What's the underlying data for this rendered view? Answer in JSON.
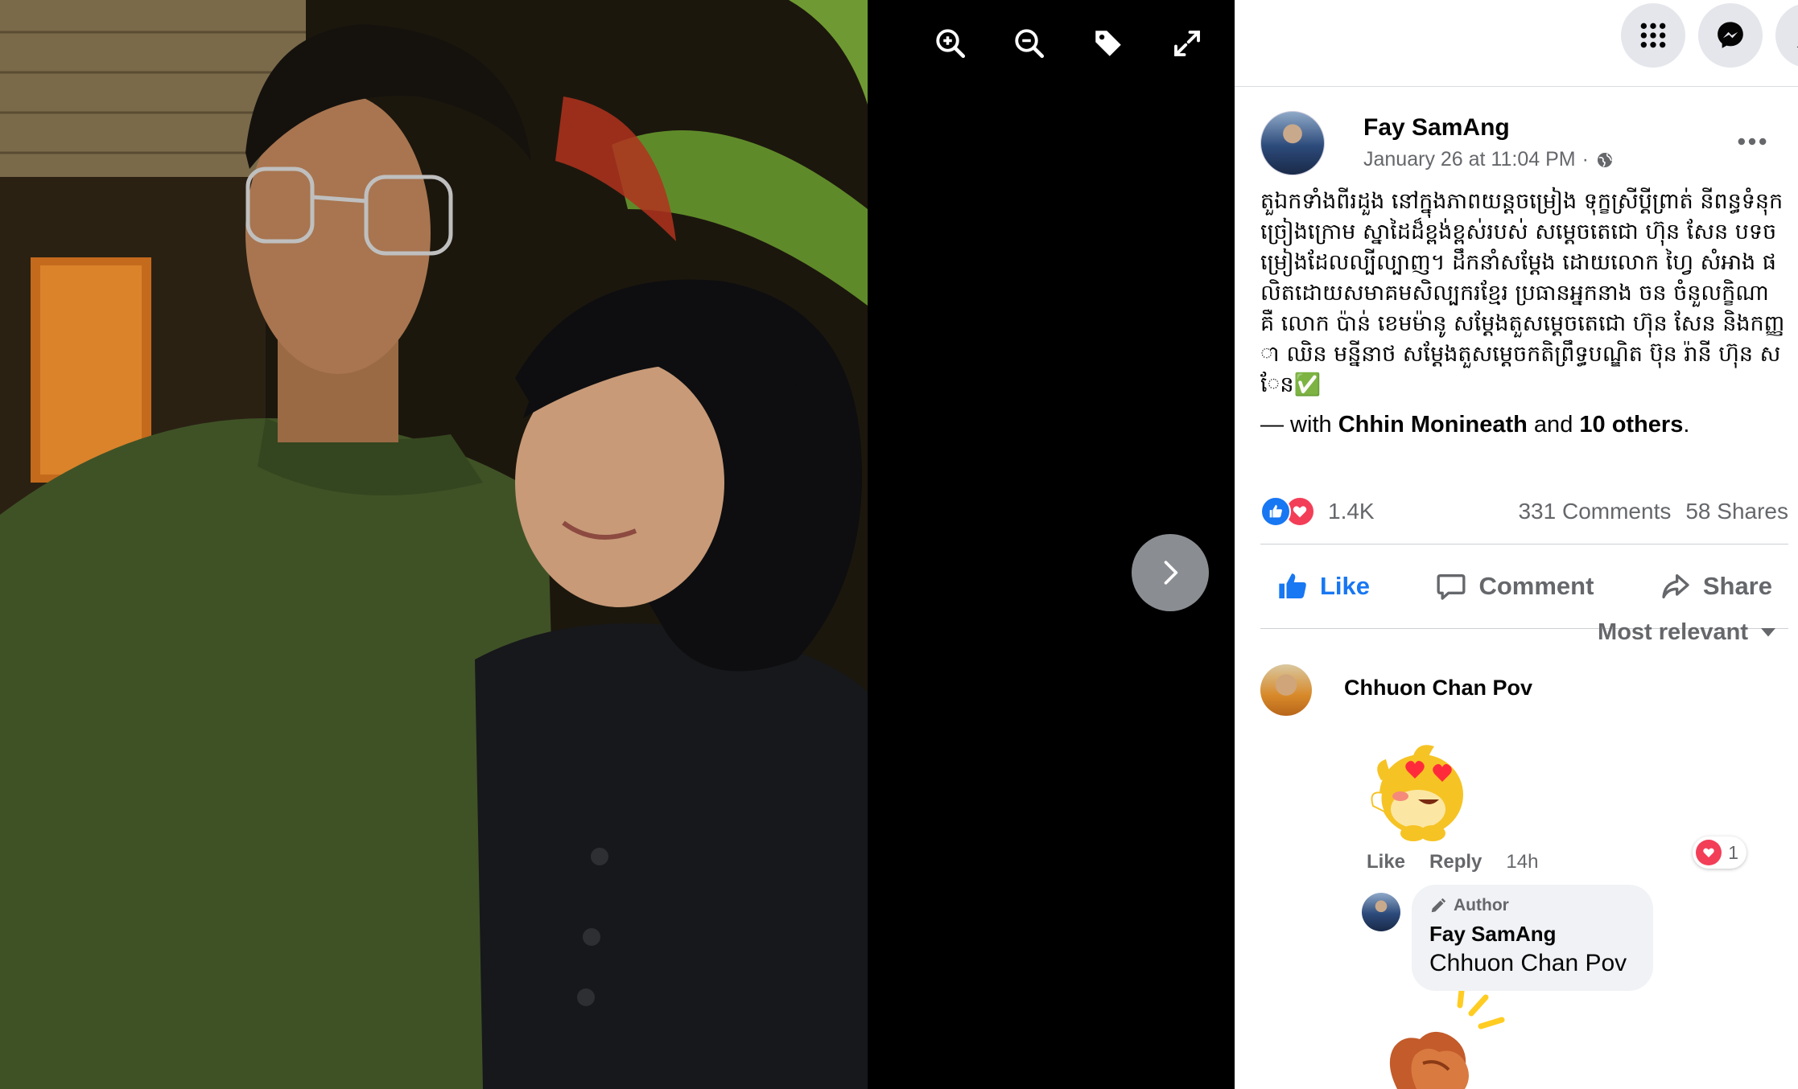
{
  "viewer": {
    "tools": [
      {
        "name": "zoom-in-icon"
      },
      {
        "name": "zoom-out-icon"
      },
      {
        "name": "tag-icon"
      },
      {
        "name": "fullscreen-icon"
      }
    ],
    "next_icon": "chevron-right-icon"
  },
  "topbar": {
    "menu_icon": "grid-menu-icon",
    "messenger_icon": "messenger-icon",
    "account_icon": "account-icon"
  },
  "post": {
    "author": "Fay SamAng",
    "date": "January 26 at 11:04 PM",
    "separator": "·",
    "privacy_icon": "globe-icon",
    "text": "តួឯកទាំងពីរដួង នៅក្នុងភាពយន្តចម្រៀង ទុក្ខស្រីប្តីព្រាត់ នីពន្ធទំនុកច្រៀងក្រោម ស្នាដៃដ៏ខ្ពង់ខ្ពស់របស់ សម្តេចតេជោ ហ៊ុន សែន បទចម្រៀងដែលល្បីល្បាញ។ ដឹកនាំសម្តែង ដោយលោក ហ្វៃ សំអាង ផលិតដោយសមាគមសិល្បករខ្មែរ ប្រធានអ្នកនាង ចន ចំនួលក្ខិណា គឺ លោក ប៉ាន់ ខេមម៉ានូ សម្តែងតួសម្តេចតេជោ ហ៊ុន សែន និងកញ្ញា ឈិន មន្នីនាថ សម្តែងតួសម្តេចកតិព្រឹទ្ធបណ្ឌិត ប៊ុន រ៉ានី ហ៊ុន សែន✅",
    "with_prefix": "— with ",
    "with_person": "Chhin Monineath",
    "with_and": " and ",
    "with_others": "10 others",
    "with_suffix": "."
  },
  "stats": {
    "reactions_count": "1.4K",
    "comments": "331 Comments",
    "shares": "58 Shares"
  },
  "actions": {
    "like": "Like",
    "comment": "Comment",
    "share": "Share"
  },
  "sort": {
    "label": "Most relevant"
  },
  "comments": [
    {
      "name": "Chhuon Chan Pov",
      "sticker": "heart-eyes-sticker",
      "like": "Like",
      "reply": "Reply",
      "time": "14h",
      "reaction_count": "1"
    }
  ],
  "reply": {
    "badge": "Author",
    "name": "Fay SamAng",
    "text": "Chhuon Chan Pov",
    "sticker": "clapping-hands-sticker"
  },
  "colors": {
    "brand_blue": "#1877f2",
    "love_red": "#f33e58",
    "muted_text": "#65676b",
    "viewer_bg": "#000000"
  }
}
